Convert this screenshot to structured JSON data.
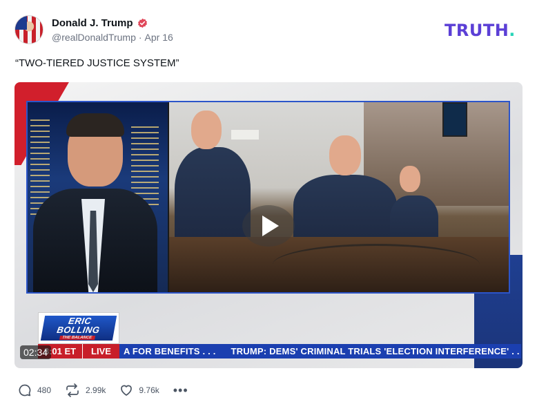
{
  "author": {
    "display_name": "Donald J. Trump",
    "handle": "@realDonaldTrump",
    "separator": "·",
    "date": "Apr 16"
  },
  "brand": {
    "logo_text": "TRUTH",
    "logo_dot": ".",
    "primary_color": "#5b3fd6",
    "dot_color": "#28d4b8"
  },
  "post": {
    "text": "“TWO-TIERED JUSTICE SYSTEM”"
  },
  "video": {
    "duration": "02:34",
    "show_logo_line1": "ERIC",
    "show_logo_line2": "BOLLING",
    "show_logo_sub": "THE BALANCE",
    "ticker_time": "8:01 ET",
    "ticker_live": "LIVE",
    "ticker_segments": [
      "A FOR BENEFITS . . .",
      "TRUMP: DEMS' CRIMINAL TRIALS 'ELECTION INTERFERENCE' . . ."
    ],
    "ticker_color": "#1b3fb0",
    "live_color": "#c81f2a"
  },
  "actions": {
    "replies": "480",
    "retruths": "2.99k",
    "likes": "9.76k",
    "more": "•••"
  },
  "icons": {
    "verified": "verified-badge-icon",
    "reply": "speech-bubble-icon",
    "retruth": "repost-arrows-icon",
    "like": "heart-icon",
    "play": "play-icon"
  }
}
